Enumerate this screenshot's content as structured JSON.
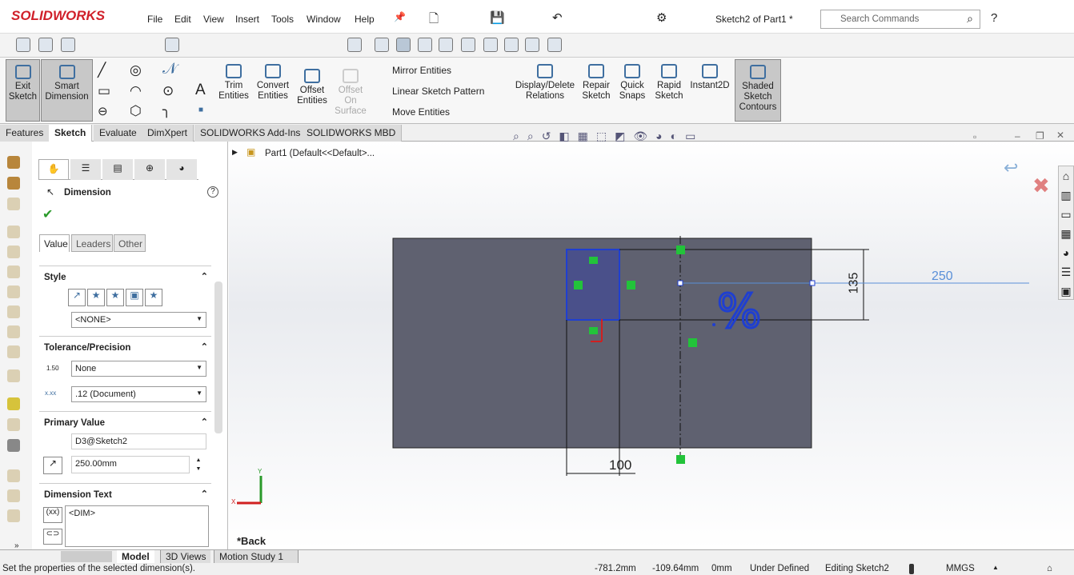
{
  "app": {
    "logo": "SOLIDWORKS",
    "title": "Sketch2 of Part1 *",
    "search_placeholder": "Search Commands"
  },
  "menu": [
    "File",
    "Edit",
    "View",
    "Insert",
    "Tools",
    "Window",
    "Help"
  ],
  "ribbon": {
    "exit_sketch": "Exit Sketch",
    "smart_dimension": "Smart Dimension",
    "trim": "Trim Entities",
    "convert": "Convert Entities",
    "offset": "Offset Entities",
    "offset_surface": "Offset On Surface",
    "mirror": "Mirror Entities",
    "linear_pattern": "Linear Sketch Pattern",
    "move": "Move Entities",
    "display_delete": "Display/Delete Relations",
    "repair": "Repair Sketch",
    "quick_snaps": "Quick Snaps",
    "rapid": "Rapid Sketch",
    "instant2d": "Instant2D",
    "shaded": "Shaded Sketch Contours"
  },
  "tabs": [
    "Features",
    "Sketch",
    "Evaluate",
    "DimXpert",
    "SOLIDWORKS Add-Ins",
    "SOLIDWORKS MBD"
  ],
  "panel": {
    "title": "Dimension",
    "subtabs": [
      "Value",
      "Leaders",
      "Other"
    ],
    "style": "Style",
    "style_value": "<NONE>",
    "tolerance": "Tolerance/Precision",
    "tol_icon": "1.50",
    "tol_value": "None",
    "precision_value": ".12 (Document)",
    "primary": "Primary Value",
    "primary_name": "D3@Sketch2",
    "primary_value": "250.00mm",
    "dim_text": "Dimension Text",
    "dim_text_value": "<DIM>"
  },
  "tree": {
    "part": "Part1  (Default<<Default>..."
  },
  "drawing": {
    "dim_horizontal": "250",
    "dim_vertical": "135",
    "dim_bottom": "100",
    "view_label": "*Back",
    "axis_x": "X",
    "axis_y": "Y"
  },
  "bottom_tabs": [
    "Model",
    "3D Views",
    "Motion Study 1"
  ],
  "status": {
    "message": "Set the properties of the selected dimension(s).",
    "x": "-781.2mm",
    "y": "-109.64mm",
    "z": "0mm",
    "state": "Under Defined",
    "editing": "Editing Sketch2",
    "units": "MMGS"
  },
  "colors": {
    "accent": "#1f3fd0",
    "part_face": "#5f6170",
    "relation": "#22c33a"
  }
}
